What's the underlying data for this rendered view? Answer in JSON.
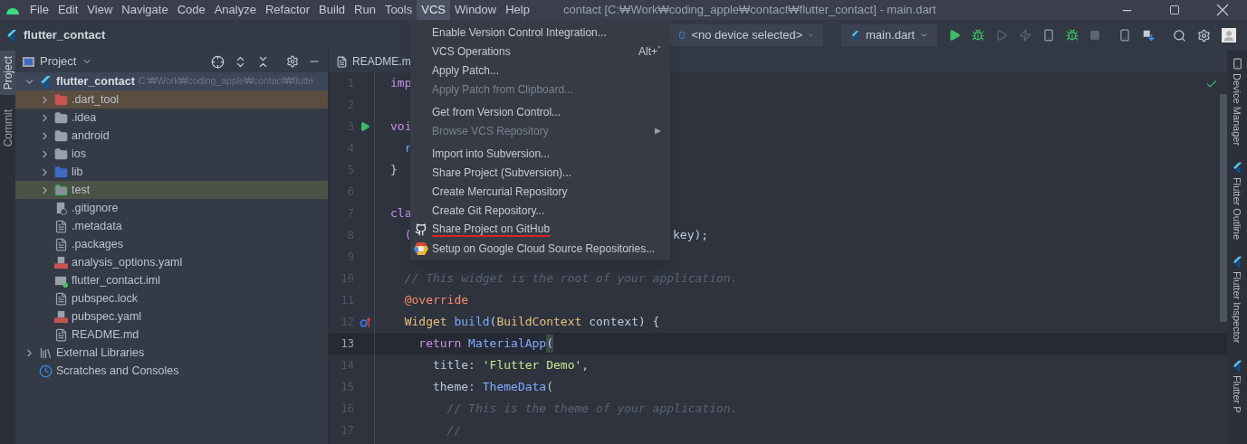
{
  "menu_bar": [
    {
      "label": "File",
      "selected": false
    },
    {
      "label": "Edit",
      "selected": false
    },
    {
      "label": "View",
      "selected": false
    },
    {
      "label": "Navigate",
      "selected": false
    },
    {
      "label": "Code",
      "selected": false
    },
    {
      "label": "Analyze",
      "selected": false
    },
    {
      "label": "Refactor",
      "selected": false
    },
    {
      "label": "Build",
      "selected": false
    },
    {
      "label": "Run",
      "selected": false
    },
    {
      "label": "Tools",
      "selected": false
    },
    {
      "label": "VCS",
      "selected": true
    },
    {
      "label": "Window",
      "selected": false
    },
    {
      "label": "Help",
      "selected": false
    }
  ],
  "window": {
    "title": "contact [C:₩Work₩coding_apple₩contact₩flutter_contact] - main.dart"
  },
  "nav_bar": {
    "project": "flutter_contact",
    "device_selector": "<no device selected>",
    "run_config": "main.dart"
  },
  "left_strip": [
    {
      "label": "Project",
      "selected": true
    },
    {
      "label": "Commit",
      "selected": false
    }
  ],
  "project_panel": {
    "title": "Project",
    "tree": [
      {
        "label": "flutter_contact",
        "path": "C:₩Work₩coding_apple₩contact₩flutte",
        "kind": "project",
        "selected": true,
        "expanded": true,
        "children": [
          {
            "label": ".dart_tool",
            "kind": "excluded_folder",
            "selected": false,
            "expanded": false
          },
          {
            "label": ".idea",
            "kind": "idea_folder",
            "selected": false,
            "expanded": false
          },
          {
            "label": "android",
            "kind": "module_folder",
            "selected": false,
            "expanded": false
          },
          {
            "label": "ios",
            "kind": "module_folder",
            "selected": false,
            "expanded": false
          },
          {
            "label": "lib",
            "kind": "source_folder",
            "selected": false,
            "expanded": false
          },
          {
            "label": "test",
            "kind": "test_folder",
            "selected": false,
            "expanded": false
          },
          {
            "label": ".gitignore",
            "kind": "ignore_file",
            "selected": false
          },
          {
            "label": ".metadata",
            "kind": "text_file",
            "selected": false
          },
          {
            "label": ".packages",
            "kind": "text_file",
            "selected": false
          },
          {
            "label": "analysis_options.yaml",
            "kind": "yaml_file",
            "selected": false
          },
          {
            "label": "flutter_contact.iml",
            "kind": "module_file",
            "selected": false
          },
          {
            "label": "pubspec.lock",
            "kind": "text_file",
            "selected": false
          },
          {
            "label": "pubspec.yaml",
            "kind": "yaml_file",
            "selected": false
          },
          {
            "label": "README.md",
            "kind": "text_file",
            "selected": false
          }
        ]
      },
      {
        "label": "External Libraries",
        "kind": "libraries",
        "selected": false,
        "expanded": false
      },
      {
        "label": "Scratches and Consoles",
        "kind": "scratches",
        "selected": false
      }
    ]
  },
  "editor": {
    "tab": "README.m",
    "lines": [
      {
        "number": "1",
        "kind": "plain",
        "current": false,
        "tokens": [
          {
            "kind": "keyword",
            "text": "imp"
          }
        ]
      },
      {
        "number": "2",
        "kind": "plain",
        "current": false
      },
      {
        "number": "3",
        "kind": "run",
        "current": false,
        "tokens": [
          {
            "kind": "keyword",
            "text": "voi"
          }
        ]
      },
      {
        "number": "4",
        "kind": "plain",
        "current": false,
        "tokens": [
          {
            "kind": "function",
            "text": "  r"
          }
        ]
      },
      {
        "number": "5",
        "kind": "plain",
        "current": false,
        "tokens": [
          {
            "kind": "plain",
            "text": "}"
          }
        ]
      },
      {
        "number": "6",
        "kind": "plain",
        "current": false
      },
      {
        "number": "7",
        "kind": "plain",
        "current": false,
        "tokens": [
          {
            "kind": "keyword",
            "text": "cla"
          }
        ]
      },
      {
        "number": "8",
        "kind": "plain",
        "current": false,
        "tokens": [
          {
            "kind": "keyword",
            "text": "  ("
          }
        ],
        "tail": "key);"
      },
      {
        "number": "9",
        "kind": "plain",
        "current": false
      },
      {
        "number": "10",
        "kind": "plain",
        "current": false,
        "tokens": [
          {
            "kind": "comment",
            "text": "  // This widget is the root of your application."
          }
        ]
      },
      {
        "number": "11",
        "kind": "plain",
        "current": false,
        "tokens": [
          {
            "kind": "annotation",
            "text": "  @override"
          }
        ]
      },
      {
        "number": "12",
        "kind": "override",
        "current": false,
        "tokens": [
          {
            "kind": "type",
            "text": "  Widget "
          },
          {
            "kind": "function",
            "text": "build"
          },
          {
            "kind": "plain",
            "text": "("
          },
          {
            "kind": "type",
            "text": "BuildContext"
          },
          {
            "kind": "plain",
            "text": " context) {"
          }
        ]
      },
      {
        "number": "13",
        "kind": "plain",
        "current": true,
        "tokens": [
          {
            "kind": "keyword",
            "text": "    return "
          },
          {
            "kind": "function",
            "text": "MaterialApp"
          },
          {
            "kind": "paren",
            "text": "("
          }
        ]
      },
      {
        "number": "14",
        "kind": "plain",
        "current": false,
        "tokens": [
          {
            "kind": "plain",
            "text": "      title: "
          },
          {
            "kind": "string",
            "text": "'Flutter Demo'"
          },
          {
            "kind": "plain",
            "text": ","
          }
        ]
      },
      {
        "number": "15",
        "kind": "plain",
        "current": false,
        "tokens": [
          {
            "kind": "plain",
            "text": "      theme: "
          },
          {
            "kind": "function",
            "text": "ThemeData"
          },
          {
            "kind": "plain",
            "text": "("
          }
        ]
      },
      {
        "number": "16",
        "kind": "plain",
        "current": false,
        "tokens": [
          {
            "kind": "comment",
            "text": "        // This is the theme of your application."
          }
        ]
      },
      {
        "number": "17",
        "kind": "plain",
        "current": false,
        "tokens": [
          {
            "kind": "comment",
            "text": "        //"
          }
        ]
      }
    ]
  },
  "vcs_menu": {
    "groups": [
      [
        {
          "label": "Enable Version Control Integration...",
          "disabled": false,
          "underlined": false
        },
        {
          "label": "VCS Operations",
          "shortcut": "Alt+`",
          "disabled": false,
          "underlined": false
        },
        {
          "label": "Apply Patch...",
          "disabled": false,
          "underlined": false
        },
        {
          "label": "Apply Patch from Clipboard...",
          "disabled": true,
          "underlined": false
        }
      ],
      [
        {
          "label": "Get from Version Control...",
          "disabled": false,
          "underlined": false
        },
        {
          "label": "Browse VCS Repository",
          "disabled": true,
          "submenu": true,
          "underlined": false
        }
      ],
      [
        {
          "label": "Import into Subversion...",
          "disabled": false,
          "underlined": false
        },
        {
          "label": "Share Project (Subversion)...",
          "disabled": false,
          "underlined": false
        },
        {
          "label": "Create Mercurial Repository",
          "disabled": false,
          "underlined": false
        },
        {
          "label": "Create Git Repository...",
          "disabled": false,
          "underlined": false
        },
        {
          "label": "Share Project on GitHub",
          "kind": "github",
          "disabled": false,
          "underlined": true
        },
        {
          "label": "Setup on Google Cloud Source Repositories...",
          "kind": "gcloud",
          "disabled": false,
          "underlined": false
        }
      ]
    ]
  },
  "right_strip": [
    {
      "label": "Device Manager",
      "kind": "device"
    },
    {
      "label": "Flutter Outline",
      "kind": "flutter"
    },
    {
      "label": "Flutter Inspector",
      "kind": "flutter"
    },
    {
      "label": "Flutter P",
      "kind": "flutter"
    }
  ]
}
